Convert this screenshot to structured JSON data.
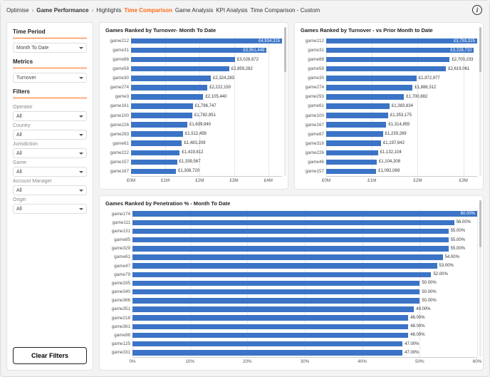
{
  "colors": {
    "accent": "#ff6a13",
    "bar": "#3b74c6"
  },
  "header": {
    "crumbs": [
      "Optimise",
      "Game Performance"
    ],
    "tabs": [
      "Highlights",
      "Time Comparison",
      "Game Analysis",
      "KPI Analysis",
      "Time Comparison - Custom"
    ],
    "active_tab": "Time Comparison"
  },
  "sidebar": {
    "time_period": {
      "title": "Time Period",
      "value": "Month To Date"
    },
    "metrics": {
      "title": "Metrics",
      "value": "Turnover"
    },
    "filters_title": "Filters",
    "filters": [
      {
        "label": "Operator",
        "value": "All"
      },
      {
        "label": "Country",
        "value": "All"
      },
      {
        "label": "Jurisdiction",
        "value": "All"
      },
      {
        "label": "Game",
        "value": "All"
      },
      {
        "label": "Account Manager",
        "value": "All"
      },
      {
        "label": "Origin",
        "value": "All"
      }
    ],
    "clear_label": "Clear Filters"
  },
  "panels": {
    "turnover_mtd_title": "Games Ranked by Turnover- Month To Date",
    "turnover_prior_title": "Games Ranked by Turnover -  vs  Prior Month to Date",
    "penetration_title": "Games Ranked by Penetration % - Month To Date"
  },
  "chart_data": [
    {
      "id": "turnover_mtd",
      "type": "bar",
      "orientation": "horizontal",
      "title": "Games Ranked by Turnover- Month To Date",
      "xlabel": "",
      "ylabel": "",
      "xlim": [
        0,
        4400000
      ],
      "xticks": [
        0,
        1000000,
        2000000,
        3000000,
        4000000
      ],
      "xticklabels": [
        "£0M",
        "£1M",
        "£2M",
        "£3M",
        "£4M"
      ],
      "value_format": "currency_gbp",
      "categories": [
        "game212",
        "game31",
        "game88",
        "game58",
        "game30",
        "game274",
        "game3",
        "game161",
        "game100",
        "game226",
        "game293",
        "game61",
        "game222",
        "game157",
        "game167"
      ],
      "values": [
        4934315,
        3951449,
        3028672,
        2859282,
        2324283,
        2222150,
        2105440,
        1796747,
        1782951,
        1639940,
        1512456,
        1483209,
        1419812,
        1339567,
        1308720
      ],
      "value_labels": [
        "£4,934,315",
        "£3,951,449",
        "£3,028,672",
        "£2,859,282",
        "£2,324,283",
        "£2,222,150",
        "£2,105,440",
        "£1,796,747",
        "£1,782,951",
        "£1,639,940",
        "£1,512,456",
        "£1,483,209",
        "£1,419,812",
        "£1,339,567",
        "£1,308,720"
      ]
    },
    {
      "id": "turnover_prior",
      "type": "bar",
      "orientation": "horizontal",
      "title": "Games Ranked by Turnover -  vs  Prior Month to Date",
      "xlabel": "",
      "ylabel": "",
      "xlim": [
        0,
        3300000
      ],
      "xticks": [
        0,
        1000000,
        2000000,
        3000000
      ],
      "xticklabels": [
        "£0M",
        "£1M",
        "£2M",
        "£3M"
      ],
      "value_format": "currency_gbp",
      "categories": [
        "game212",
        "game31",
        "game88",
        "game58",
        "game30",
        "game274",
        "game293",
        "game61",
        "game100",
        "game167",
        "game87",
        "game316",
        "game226",
        "game46",
        "game157"
      ],
      "values": [
        3793325,
        3228710,
        2700233,
        2619061,
        1972977,
        1888312,
        1700882,
        1383834,
        1353175,
        1314855,
        1239269,
        1197642,
        1132104,
        1104208,
        1092069
      ],
      "value_labels": [
        "£3,793,325",
        "£3,228,710",
        "£2,700,233",
        "£2,619,061",
        "£1,972,977",
        "£1,888,312",
        "£1,700,882",
        "£1,383,834",
        "£1,353,175",
        "£1,314,855",
        "£1,239,269",
        "£1,197,642",
        "£1,132,104",
        "£1,104,208",
        "£1,092,069"
      ]
    },
    {
      "id": "penetration",
      "type": "bar",
      "orientation": "horizontal",
      "title": "Games Ranked by Penetration % - Month To Date",
      "xlabel": "",
      "ylabel": "",
      "xlim": [
        0,
        60
      ],
      "xticks": [
        0,
        10,
        20,
        30,
        40,
        50,
        60
      ],
      "xticklabels": [
        "0%",
        "10%",
        "20%",
        "30%",
        "40%",
        "50%",
        "60%"
      ],
      "value_format": "percent",
      "categories": [
        "game174",
        "game111",
        "game131",
        "game85",
        "game329",
        "game61",
        "game47",
        "game79",
        "game335",
        "game340",
        "game366",
        "game351",
        "game218",
        "game361",
        "game98",
        "game125",
        "game331"
      ],
      "values": [
        60.0,
        56.0,
        55.0,
        55.0,
        55.0,
        54.0,
        53.0,
        52.0,
        50.0,
        50.0,
        50.0,
        49.0,
        48.0,
        48.0,
        48.0,
        47.0,
        47.0
      ],
      "value_labels": [
        "60.00%",
        "56.00%",
        "55.00%",
        "55.00%",
        "55.00%",
        "54.00%",
        "53.00%",
        "52.00%",
        "50.00%",
        "50.00%",
        "50.00%",
        "49.00%",
        "48.00%",
        "48.00%",
        "48.00%",
        "47.00%",
        "47.00%"
      ]
    }
  ]
}
